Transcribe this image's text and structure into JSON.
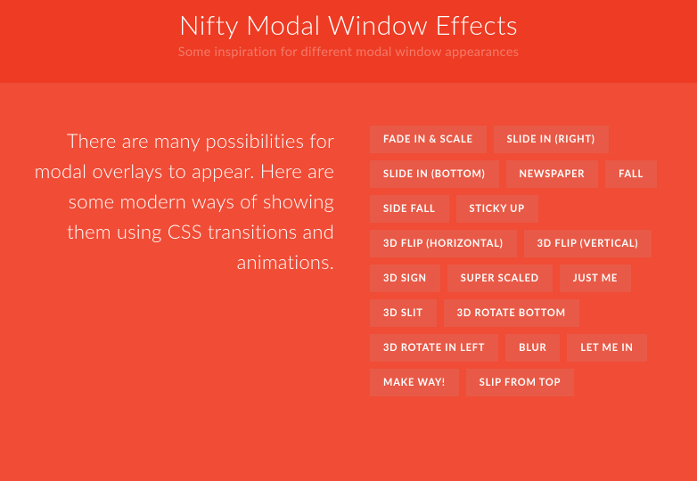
{
  "header": {
    "title": "Nifty Modal Window Effects",
    "subtitle": "Some inspiration for different modal window appearances"
  },
  "description": "There are many possibilities for modal overlays to appear. Here are some modern ways of showing them using CSS transitions and animations.",
  "buttons": [
    "FADE IN & SCALE",
    "SLIDE IN (RIGHT)",
    "SLIDE IN (BOTTOM)",
    "NEWSPAPER",
    "FALL",
    "SIDE FALL",
    "STICKY UP",
    "3D FLIP (HORIZONTAL)",
    "3D FLIP (VERTICAL)",
    "3D SIGN",
    "SUPER SCALED",
    "JUST ME",
    "3D SLIT",
    "3D ROTATE BOTTOM",
    "3D ROTATE IN LEFT",
    "BLUR",
    "LET ME IN",
    "MAKE WAY!",
    "SLIP FROM TOP"
  ]
}
